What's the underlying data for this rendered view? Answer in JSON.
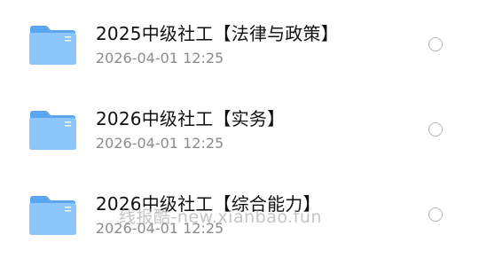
{
  "files": [
    {
      "name": "2025中级社工【法律与政策】",
      "date": "2026-04-01 12:25",
      "icon": "folder-icon",
      "selected": false
    },
    {
      "name": "2026中级社工【实务】",
      "date": "2026-04-01 12:25",
      "icon": "folder-icon",
      "selected": false
    },
    {
      "name": "2026中级社工【综合能力】",
      "date": "2026-04-01 12:25",
      "icon": "folder-icon",
      "selected": false
    }
  ],
  "watermark": "线报酷-new.xianbao.fun",
  "colors": {
    "folder_back": "#5aa7f0",
    "folder_front": "#8cc6fb",
    "title": "#111111",
    "meta": "#8c8c8c",
    "radio_border": "#b8b8b8"
  }
}
